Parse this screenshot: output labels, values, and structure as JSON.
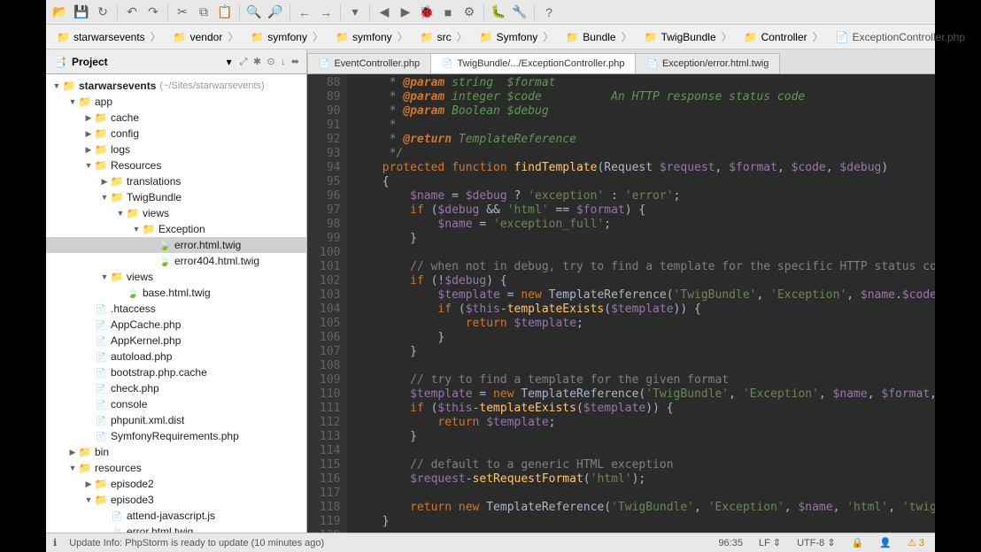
{
  "toolbar_icons": [
    "folder-open",
    "save",
    "refresh",
    "undo",
    "redo",
    "cut",
    "copy",
    "paste",
    "search",
    "zoom",
    "back",
    "forward",
    "dropdown",
    "play-left",
    "play",
    "debug",
    "stop",
    "play-gear",
    "bug",
    "settings",
    "help"
  ],
  "breadcrumb": [
    {
      "icon": "folder",
      "label": "starwarsevents"
    },
    {
      "icon": "folder",
      "label": "vendor"
    },
    {
      "icon": "folder",
      "label": "symfony"
    },
    {
      "icon": "folder",
      "label": "symfony"
    },
    {
      "icon": "folder",
      "label": "src"
    },
    {
      "icon": "folder",
      "label": "Symfony"
    },
    {
      "icon": "folder",
      "label": "Bundle"
    },
    {
      "icon": "folder",
      "label": "TwigBundle"
    },
    {
      "icon": "folder",
      "label": "Controller"
    },
    {
      "icon": "file",
      "label": "ExceptionController.php"
    }
  ],
  "project_title": "Project",
  "tabs": [
    {
      "label": "EventController.php",
      "active": false
    },
    {
      "label": "TwigBundle/.../ExceptionController.php",
      "active": true
    },
    {
      "label": "Exception/error.html.twig",
      "active": false
    }
  ],
  "tree": [
    {
      "d": 0,
      "a": "v",
      "i": "folder",
      "t": "starwarsevents",
      "hint": "(~/Sites/starwarsevents)",
      "bold": true
    },
    {
      "d": 1,
      "a": "v",
      "i": "folder",
      "t": "app"
    },
    {
      "d": 2,
      "a": ">",
      "i": "folder",
      "t": "cache"
    },
    {
      "d": 2,
      "a": ">",
      "i": "folder",
      "t": "config"
    },
    {
      "d": 2,
      "a": ">",
      "i": "folder",
      "t": "logs"
    },
    {
      "d": 2,
      "a": "v",
      "i": "folder",
      "t": "Resources"
    },
    {
      "d": 3,
      "a": ">",
      "i": "folder",
      "t": "translations"
    },
    {
      "d": 3,
      "a": "v",
      "i": "folder",
      "t": "TwigBundle"
    },
    {
      "d": 4,
      "a": "v",
      "i": "folder",
      "t": "views"
    },
    {
      "d": 5,
      "a": "v",
      "i": "folder",
      "t": "Exception"
    },
    {
      "d": 6,
      "a": " ",
      "i": "twig",
      "t": "error.html.twig",
      "sel": true
    },
    {
      "d": 6,
      "a": " ",
      "i": "twig",
      "t": "error404.html.twig"
    },
    {
      "d": 3,
      "a": "v",
      "i": "folder",
      "t": "views"
    },
    {
      "d": 4,
      "a": " ",
      "i": "twig",
      "t": "base.html.twig"
    },
    {
      "d": 2,
      "a": " ",
      "i": "file",
      "t": ".htaccess"
    },
    {
      "d": 2,
      "a": " ",
      "i": "php",
      "t": "AppCache.php"
    },
    {
      "d": 2,
      "a": " ",
      "i": "php",
      "t": "AppKernel.php"
    },
    {
      "d": 2,
      "a": " ",
      "i": "php",
      "t": "autoload.php"
    },
    {
      "d": 2,
      "a": " ",
      "i": "file",
      "t": "bootstrap.php.cache"
    },
    {
      "d": 2,
      "a": " ",
      "i": "php",
      "t": "check.php"
    },
    {
      "d": 2,
      "a": " ",
      "i": "file",
      "t": "console"
    },
    {
      "d": 2,
      "a": " ",
      "i": "file",
      "t": "phpunit.xml.dist"
    },
    {
      "d": 2,
      "a": " ",
      "i": "php",
      "t": "SymfonyRequirements.php"
    },
    {
      "d": 1,
      "a": ">",
      "i": "folder",
      "t": "bin"
    },
    {
      "d": 1,
      "a": "v",
      "i": "folder",
      "t": "resources"
    },
    {
      "d": 2,
      "a": ">",
      "i": "folder",
      "t": "episode2"
    },
    {
      "d": 2,
      "a": "v",
      "i": "folder",
      "t": "episode3"
    },
    {
      "d": 3,
      "a": " ",
      "i": "js",
      "t": "attend-javascript.js"
    },
    {
      "d": 3,
      "a": " ",
      "i": "twig",
      "t": "error.html.twig"
    }
  ],
  "line_start": 88,
  "line_end": 120,
  "code_lines": [
    "     * <t>@param</t> <d>string  $format</d>",
    "     * <t>@param</t> <d>integer $code          An HTTP response status code</d>",
    "     * <t>@param</t> <d>Boolean $debug</d>",
    "     *",
    "     * <t>@return</t> <d>TemplateReference</d>",
    "     */",
    "    <k>protected function</k> <f>findTemplate</f>(<c>Request</c> <v>$request</v>, <v>$format</v>, <v>$code</v>, <v>$debug</v>)",
    "    {",
    "        <v>$name</v> = <v>$debug</v> ? <s>'exception'</s> : <s>'error'</s>;",
    "        <k>if</k> (<v>$debug</v> && <s>'html'</s> == <v>$format</v>) {",
    "            <v>$name</v> = <s>'exception_full'</s>;",
    "        }",
    "",
    "        <m>// when not in debug, try to find a template for the specific HTTP status code and f</m>",
    "        <k>if</k> (!<v>$debug</v>) {",
    "            <v>$template</v> = <k>new</k> <c>TemplateReference</c>(<s>'TwigBundle'</s>, <s>'Exception'</s>, <v>$name</v>.<v>$code</v>, <v>$forma</v>",
    "            <k>if</k> (<v>$this</v>-><f>templateExists</f>(<v>$template</v>)) {",
    "                <k>return</k> <v>$template</v>;",
    "            }",
    "        }",
    "",
    "        <m>// try to find a template for the given format</m>",
    "        <v>$template</v> = <k>new</k> <c>TemplateReference</c>(<s>'TwigBundle'</s>, <s>'Exception'</s>, <v>$name</v>, <v>$format</v>, <s>'twig'</s>)",
    "        <k>if</k> (<v>$this</v>-><f>templateExists</f>(<v>$template</v>)) {",
    "            <k>return</k> <v>$template</v>;",
    "        }",
    "",
    "        <m>// default to a generic HTML exception</m>",
    "        <v>$request</v>-><f>setRequestFormat</f>(<s>'html'</s>);",
    "",
    "        <k>return new</k> <c>TemplateReference</c>(<s>'TwigBundle'</s>, <s>'Exception'</s>, <v>$name</v>, <s>'html'</s>, <s>'twig'</s>);",
    "    }",
    ""
  ],
  "status": {
    "msg": "Update Info: PhpStorm is ready to update (10 minutes ago)",
    "pos": "96:35",
    "lf": "LF",
    "enc": "UTF-8",
    "warn": "3"
  },
  "icon_glyphs": {
    "folder-open": "📂",
    "save": "💾",
    "refresh": "↻",
    "undo": "↶",
    "redo": "↷",
    "cut": "✂",
    "copy": "⧉",
    "paste": "📋",
    "search": "🔍",
    "zoom": "🔎",
    "back": "←",
    "forward": "→",
    "dropdown": "▾",
    "play-left": "◀",
    "play": "▶",
    "debug": "🐞",
    "stop": "■",
    "play-gear": "⚙",
    "bug": "🐛",
    "settings": "🔧",
    "help": "?"
  }
}
